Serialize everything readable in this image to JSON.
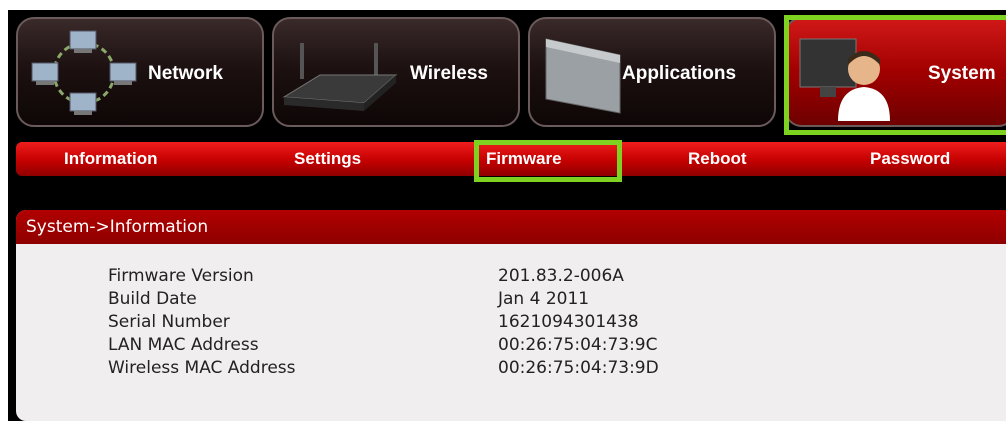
{
  "main_tabs": [
    {
      "label": "Network",
      "icon": "network-icon"
    },
    {
      "label": "Wireless",
      "icon": "router-icon"
    },
    {
      "label": "Applications",
      "icon": "applications-icon"
    },
    {
      "label": "System",
      "icon": "user-computer-icon",
      "active": true
    }
  ],
  "sub_tabs": [
    {
      "label": "Information",
      "active": true
    },
    {
      "label": "Settings"
    },
    {
      "label": "Firmware",
      "highlighted": true
    },
    {
      "label": "Reboot"
    },
    {
      "label": "Password"
    }
  ],
  "panel": {
    "title": "System->Information",
    "rows": [
      {
        "label": "Firmware Version",
        "value": "201.83.2-006A"
      },
      {
        "label": "Build Date",
        "value": "Jan 4 2011"
      },
      {
        "label": "Serial Number",
        "value": "1621094301438"
      },
      {
        "label": "LAN MAC Address",
        "value": "00:26:75:04:73:9C"
      },
      {
        "label": "Wireless MAC Address",
        "value": "00:26:75:04:73:9D"
      }
    ]
  },
  "colors": {
    "highlight": "#7ed321",
    "nav_red": "#c40000",
    "panel_header": "#a00000",
    "panel_bg": "#f0eeee"
  }
}
